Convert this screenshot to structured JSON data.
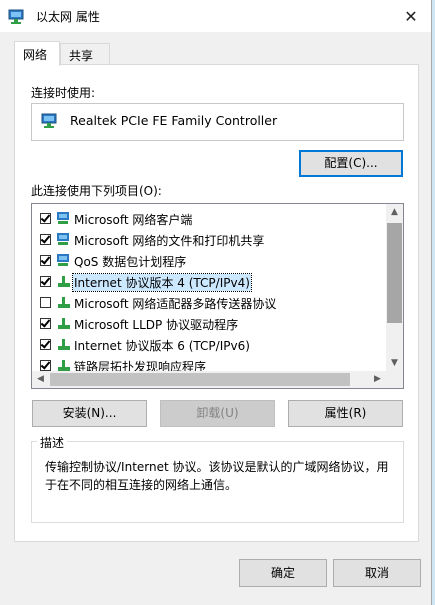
{
  "window": {
    "title": "以太网 属性",
    "close_glyph": "✕"
  },
  "tabs": [
    {
      "label": "网络",
      "active": true
    },
    {
      "label": "共享",
      "active": false
    }
  ],
  "connect_using": {
    "label": "连接时使用:",
    "adapter": "Realtek PCIe FE Family Controller"
  },
  "configure_button": "配置(C)...",
  "items_label": "此连接使用下列项目(O):",
  "items": [
    {
      "label": "Microsoft 网络客户端",
      "checked": true,
      "icon": "network-client-icon"
    },
    {
      "label": "Microsoft 网络的文件和打印机共享",
      "checked": true,
      "icon": "network-client-icon"
    },
    {
      "label": "QoS 数据包计划程序",
      "checked": true,
      "icon": "network-client-icon"
    },
    {
      "label": "Internet 协议版本 4 (TCP/IPv4)",
      "checked": true,
      "icon": "protocol-icon",
      "selected": true
    },
    {
      "label": "Microsoft 网络适配器多路传送器协议",
      "checked": false,
      "icon": "protocol-icon"
    },
    {
      "label": "Microsoft LLDP 协议驱动程序",
      "checked": true,
      "icon": "protocol-icon"
    },
    {
      "label": "Internet 协议版本 6 (TCP/IPv6)",
      "checked": true,
      "icon": "protocol-icon"
    },
    {
      "label": "链路层拓扑发现响应程序",
      "checked": true,
      "icon": "protocol-icon"
    }
  ],
  "buttons": {
    "install": "安装(N)...",
    "uninstall": "卸载(U)",
    "properties": "属性(R)"
  },
  "description": {
    "title": "描述",
    "text": "传输控制协议/Internet 协议。该协议是默认的广域网络协议，用于在不同的相互连接的网络上通信。"
  },
  "footer": {
    "ok": "确定",
    "cancel": "取消"
  },
  "colors": {
    "selection": "#cce8ff",
    "focus_border": "#0078d7",
    "icon_blue": "#1e73be",
    "icon_green": "#2f9e44"
  }
}
